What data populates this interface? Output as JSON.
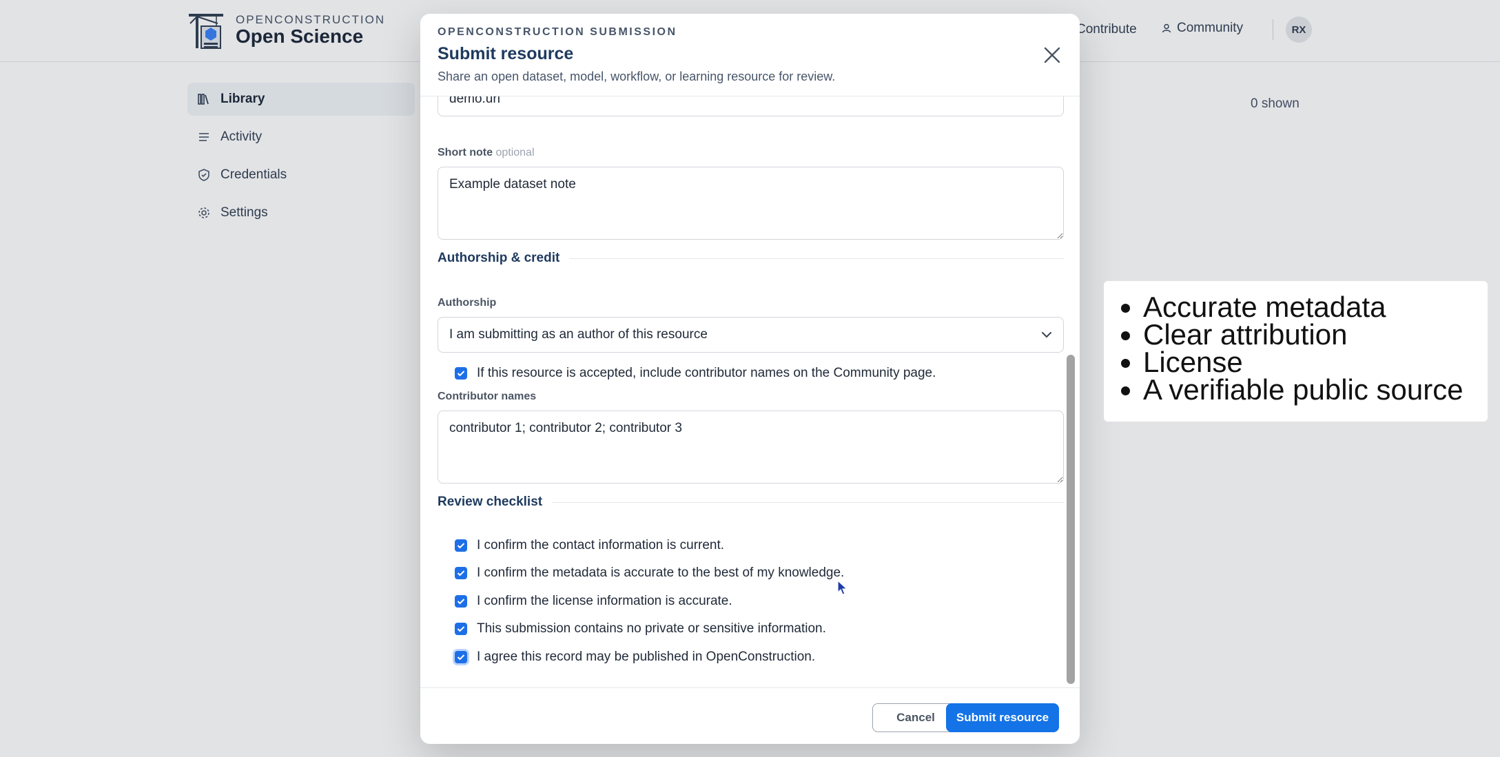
{
  "app": {
    "brand_small": "OPENCONSTRUCTION",
    "brand_big": "Open Science",
    "nav_contribute": "Contribute",
    "nav_community": "Community",
    "avatar_initials": "RX",
    "shown_count": "0 shown"
  },
  "sidebar": {
    "items": [
      {
        "label": "Library",
        "icon": "library-icon",
        "active": true
      },
      {
        "label": "Activity",
        "icon": "list-icon",
        "active": false
      },
      {
        "label": "Credentials",
        "icon": "shield-icon",
        "active": false
      },
      {
        "label": "Settings",
        "icon": "gear-icon",
        "active": false
      }
    ]
  },
  "modal": {
    "eyebrow": "OPENCONSTRUCTION SUBMISSION",
    "title": "Submit resource",
    "subtitle": "Share an open dataset, model, workflow, or learning resource for review.",
    "url_value": "demo.url",
    "short_note_label": "Short note",
    "short_note_optional": "optional",
    "short_note_value": "Example dataset note",
    "section_authorship": "Authorship & credit",
    "authorship_label": "Authorship",
    "authorship_selected": "I am submitting as an author of this resource",
    "include_names_label": "If this resource is accepted, include contributor names on the Community page.",
    "contributor_names_label": "Contributor names",
    "contributor_names_value": "contributor 1; contributor 2; contributor 3",
    "section_review": "Review checklist",
    "checklist": [
      "I confirm the contact information is current.",
      "I confirm the metadata is accurate to the best of my knowledge.",
      "I confirm the license information is accurate.",
      "This submission contains no private or sensitive information.",
      "I agree this record may be published in OpenConstruction."
    ],
    "cancel_label": "Cancel",
    "submit_label": "Submit resource"
  },
  "callout": {
    "items": [
      "Accurate metadata",
      "Clear attribution",
      "License",
      "A verifiable public source"
    ]
  },
  "colors": {
    "accent": "#1473e6",
    "checkbox": "#1d6fe8",
    "heading": "#1e3a5f"
  }
}
